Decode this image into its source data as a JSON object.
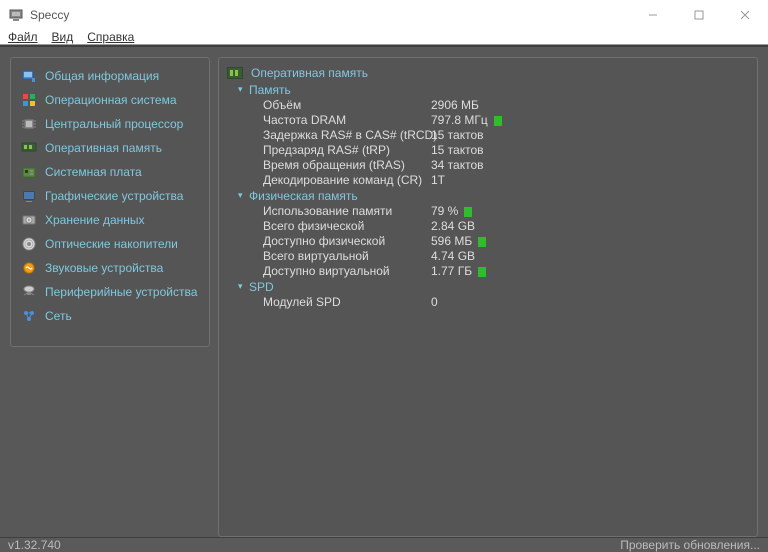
{
  "titlebar": {
    "title": "Speccy"
  },
  "menubar": {
    "file": "Файл",
    "view": "Вид",
    "help": "Справка"
  },
  "sidebar": {
    "items": [
      {
        "label": "Общая информация"
      },
      {
        "label": "Операционная система"
      },
      {
        "label": "Центральный процессор"
      },
      {
        "label": "Оперативная память"
      },
      {
        "label": "Системная плата"
      },
      {
        "label": "Графические устройства"
      },
      {
        "label": "Хранение данных"
      },
      {
        "label": "Оптические накопители"
      },
      {
        "label": "Звуковые устройства"
      },
      {
        "label": "Периферийные устройства"
      },
      {
        "label": "Сеть"
      }
    ]
  },
  "main": {
    "title": "Оперативная память",
    "groups": [
      {
        "name": "Память",
        "rows": [
          {
            "key": "Объём",
            "val": "2906 МБ",
            "indicator": false
          },
          {
            "key": "Частота DRAM",
            "val": "797.8 МГц",
            "indicator": true
          },
          {
            "key": "Задержка RAS# в CAS# (tRCD)",
            "val": "15 тактов",
            "indicator": false
          },
          {
            "key": "Предзаряд RAS# (tRP)",
            "val": "15 тактов",
            "indicator": false
          },
          {
            "key": "Время обращения (tRAS)",
            "val": "34 тактов",
            "indicator": false
          },
          {
            "key": "Декодирование команд (CR)",
            "val": "1T",
            "indicator": false
          }
        ]
      },
      {
        "name": "Физическая память",
        "rows": [
          {
            "key": "Использование памяти",
            "val": "79 %",
            "indicator": true
          },
          {
            "key": "Всего физической",
            "val": "2.84 GB",
            "indicator": false
          },
          {
            "key": "Доступно физической",
            "val": "596 МБ",
            "indicator": true
          },
          {
            "key": "Всего виртуальной",
            "val": "4.74 GB",
            "indicator": false
          },
          {
            "key": "Доступно виртуальной",
            "val": "1.77 ГБ",
            "indicator": true
          }
        ]
      },
      {
        "name": "SPD",
        "rows": [
          {
            "key": "Модулей SPD",
            "val": "0",
            "indicator": false
          }
        ]
      }
    ]
  },
  "statusbar": {
    "version": "v1.32.740",
    "update": "Проверить обновления..."
  }
}
